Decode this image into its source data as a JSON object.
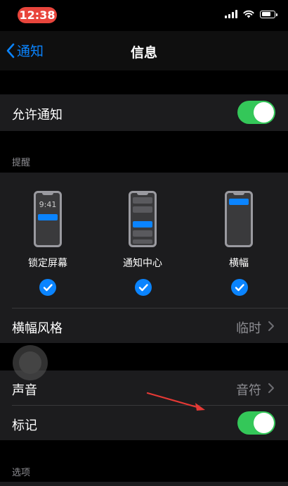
{
  "status_bar": {
    "time": "12:38",
    "icons": [
      "signal-icon",
      "wifi-icon",
      "battery-icon"
    ]
  },
  "nav": {
    "back_label": "通知",
    "title": "信息"
  },
  "allow_notifications": {
    "label": "允许通知",
    "enabled": true
  },
  "alerts": {
    "header": "提醒",
    "styles": [
      {
        "label": "锁定屏幕",
        "checked": true,
        "preview_time": "9:41"
      },
      {
        "label": "通知中心",
        "checked": true
      },
      {
        "label": "横幅",
        "checked": true
      }
    ],
    "banner_style": {
      "label": "横幅风格",
      "value": "临时"
    }
  },
  "sounds": {
    "label": "声音",
    "value": "音符"
  },
  "badges": {
    "label": "标记",
    "enabled": true
  },
  "options": {
    "header": "选项"
  },
  "colors": {
    "accent": "#0a84ff",
    "toggle_on": "#34c759",
    "cell_bg": "#1c1c1e",
    "secondary_text": "#8e8e93",
    "annotation_arrow": "#e53935"
  }
}
